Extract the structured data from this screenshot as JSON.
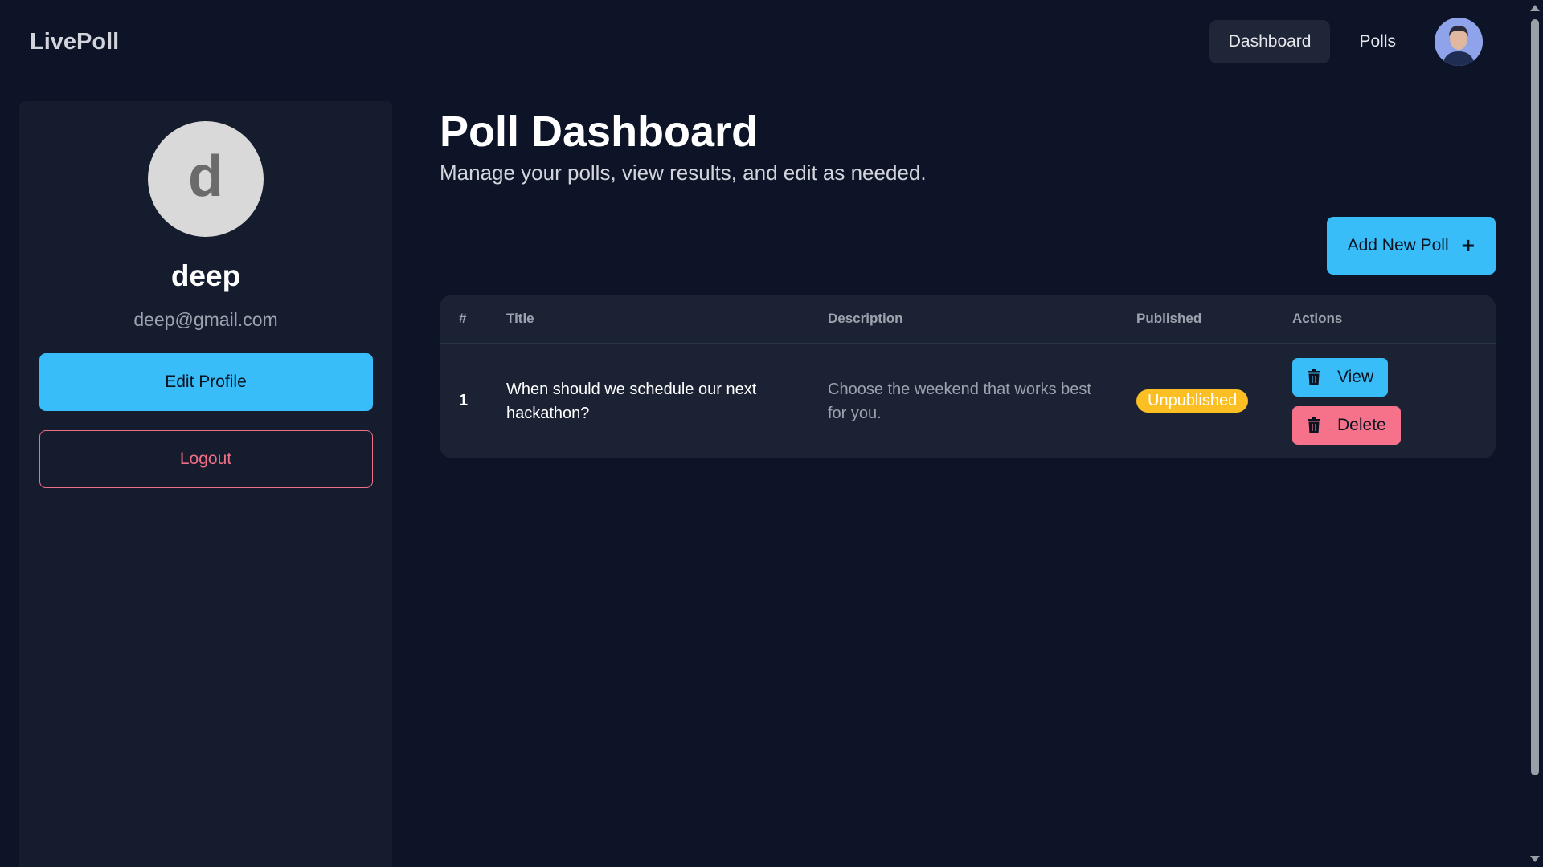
{
  "navbar": {
    "brand": "LivePoll",
    "links": [
      {
        "label": "Dashboard",
        "active": true
      },
      {
        "label": "Polls",
        "active": false
      }
    ]
  },
  "sidebar": {
    "avatar_letter": "d",
    "name": "deep",
    "email": "deep@gmail.com",
    "edit_label": "Edit Profile",
    "logout_label": "Logout"
  },
  "main": {
    "title": "Poll Dashboard",
    "subtitle": "Manage your polls, view results, and edit as needed.",
    "add_button_label": "Add New Poll",
    "table": {
      "headers": [
        "#",
        "Title",
        "Description",
        "Published",
        "Actions"
      ],
      "rows": [
        {
          "num": "1",
          "title": "When should we schedule our next hackathon?",
          "description": "Choose the weekend that works best for you.",
          "status": "Unpublished",
          "view_label": "View",
          "delete_label": "Delete"
        }
      ]
    }
  },
  "colors": {
    "background": "#0d1427",
    "panel": "#141c2e",
    "accent": "#38bdf8",
    "danger": "#f5728a",
    "warning": "#fbbf24"
  }
}
